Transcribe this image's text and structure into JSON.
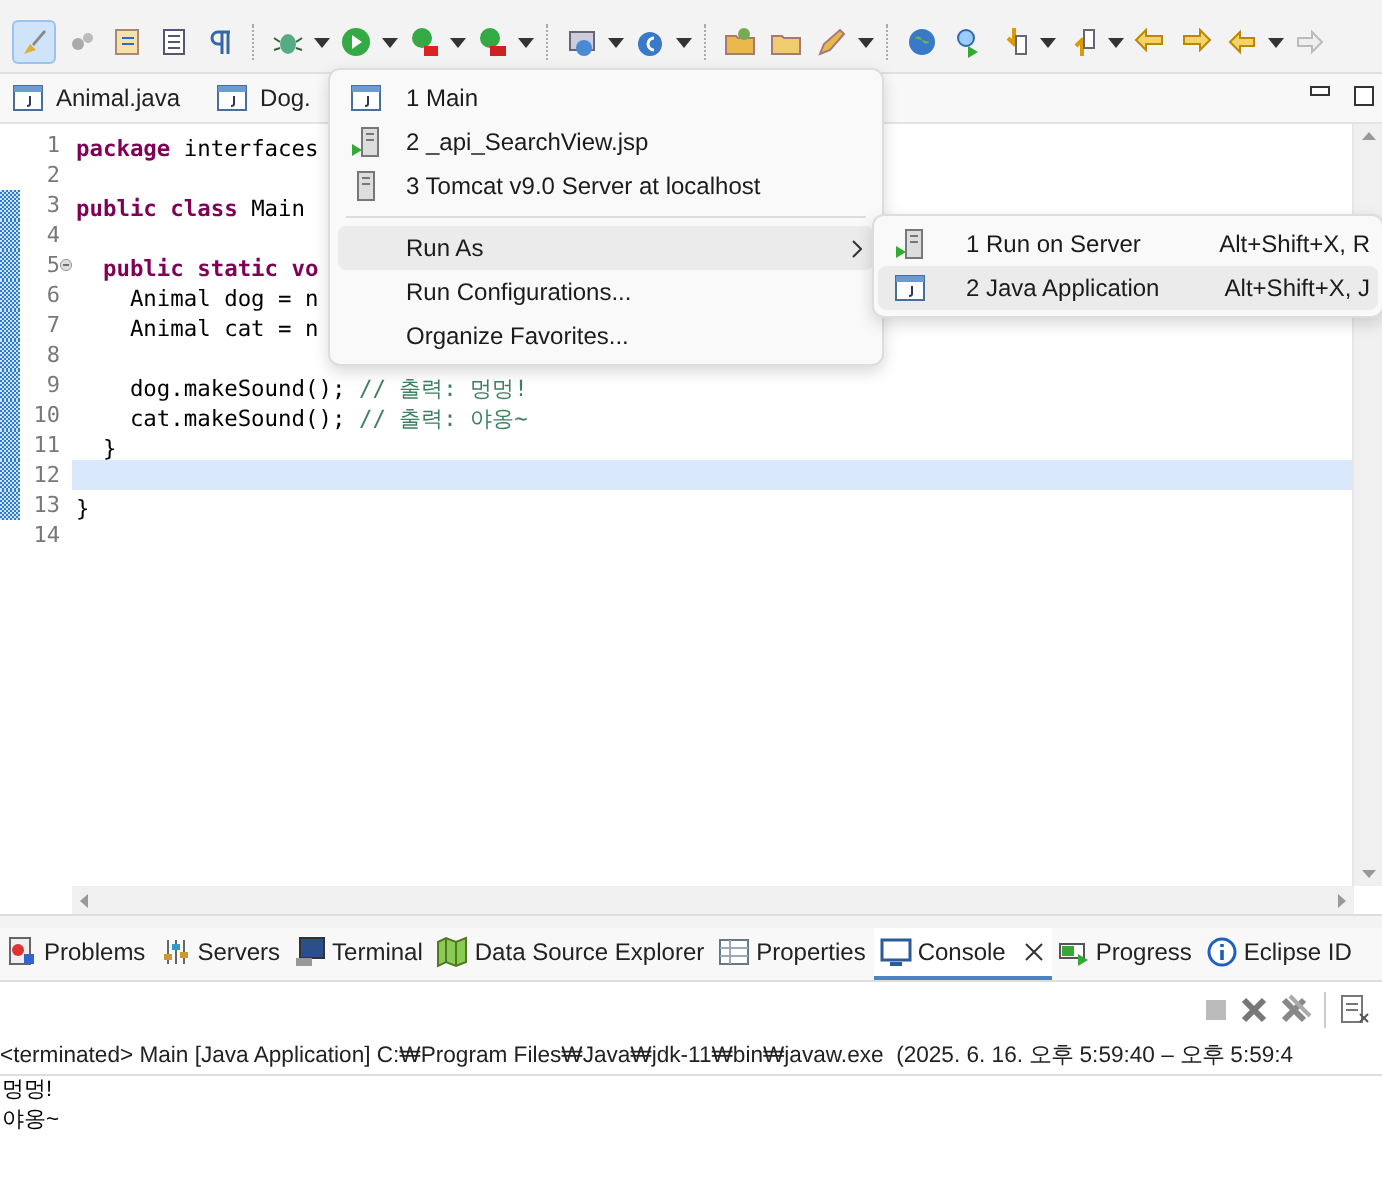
{
  "editor_tabs": [
    {
      "label": "Animal.java"
    },
    {
      "label": "Dog."
    }
  ],
  "editor": {
    "lines": [
      {
        "number": "1",
        "changed": false,
        "current": false,
        "fold": false,
        "tokens": [
          {
            "kind": "keyword",
            "text": "package"
          },
          {
            "kind": "plain",
            "text": " interfaces"
          }
        ]
      },
      {
        "number": "2",
        "changed": false,
        "current": false,
        "fold": false
      },
      {
        "number": "3",
        "changed": true,
        "current": false,
        "fold": false,
        "tokens": [
          {
            "kind": "keyword",
            "text": "public class"
          },
          {
            "kind": "plain",
            "text": " Main"
          }
        ]
      },
      {
        "number": "4",
        "changed": true,
        "current": false,
        "fold": false
      },
      {
        "number": "5",
        "changed": true,
        "current": false,
        "fold": true,
        "tokens": [
          {
            "kind": "keyword",
            "text": "  public static vo"
          }
        ]
      },
      {
        "number": "6",
        "changed": true,
        "current": false,
        "fold": false,
        "tokens": [
          {
            "kind": "plain",
            "text": "    Animal dog = n"
          }
        ]
      },
      {
        "number": "7",
        "changed": true,
        "current": false,
        "fold": false,
        "tokens": [
          {
            "kind": "plain",
            "text": "    Animal cat = n"
          }
        ]
      },
      {
        "number": "8",
        "changed": true,
        "current": false,
        "fold": false
      },
      {
        "number": "9",
        "changed": true,
        "current": false,
        "fold": false,
        "tokens": [
          {
            "kind": "plain",
            "text": "    dog.makeSound(); "
          },
          {
            "kind": "comment",
            "text": "// 출력: 멍멍!"
          }
        ]
      },
      {
        "number": "10",
        "changed": true,
        "current": false,
        "fold": false,
        "tokens": [
          {
            "kind": "plain",
            "text": "    cat.makeSound(); "
          },
          {
            "kind": "comment",
            "text": "// 출력: 야옹~"
          }
        ]
      },
      {
        "number": "11",
        "changed": true,
        "current": false,
        "fold": false,
        "tokens": [
          {
            "kind": "plain",
            "text": "  }"
          }
        ]
      },
      {
        "number": "12",
        "changed": true,
        "current": true,
        "fold": false
      },
      {
        "number": "13",
        "changed": true,
        "current": false,
        "fold": false,
        "tokens": [
          {
            "kind": "plain",
            "text": "}"
          }
        ]
      },
      {
        "number": "14",
        "changed": false,
        "current": false,
        "fold": false
      }
    ]
  },
  "run_menu": {
    "recent": [
      {
        "kind": "java",
        "label": "1 Main"
      },
      {
        "kind": "server-run",
        "label": "2 _api_SearchView.jsp"
      },
      {
        "kind": "server",
        "label": "3 Tomcat v9.0 Server at localhost"
      }
    ],
    "items": [
      {
        "label": "Run As",
        "submenu": true,
        "selected": true
      },
      {
        "label": "Run Configurations...",
        "submenu": false,
        "selected": false
      },
      {
        "label": "Organize Favorites...",
        "submenu": false,
        "selected": false
      }
    ]
  },
  "run_as_submenu": [
    {
      "kind": "server-run",
      "label": "1 Run on Server",
      "shortcut": "Alt+Shift+X, R",
      "selected": false
    },
    {
      "kind": "java",
      "label": "2 Java Application",
      "shortcut": "Alt+Shift+X, J",
      "selected": true
    }
  ],
  "view_tabs": [
    {
      "kind": "problems",
      "label": "Problems",
      "selected": false,
      "closable": false
    },
    {
      "kind": "servers",
      "label": "Servers",
      "selected": false,
      "closable": false
    },
    {
      "kind": "terminal",
      "label": "Terminal",
      "selected": false,
      "closable": false
    },
    {
      "kind": "datasource",
      "label": "Data Source Explorer",
      "selected": false,
      "closable": false
    },
    {
      "kind": "properties",
      "label": "Properties",
      "selected": false,
      "closable": false
    },
    {
      "kind": "console",
      "label": "Console",
      "selected": true,
      "closable": true
    },
    {
      "kind": "progress",
      "label": "Progress",
      "selected": false,
      "closable": false
    },
    {
      "kind": "info",
      "label": "Eclipse ID",
      "selected": false,
      "closable": false
    }
  ],
  "console": {
    "header": "<terminated> Main [Java Application] C:₩Program Files₩Java₩jdk-11₩bin₩javaw.exe  (2025. 6. 16. 오후 5:59:40 – 오후 5:59:4",
    "output": [
      "멍멍!",
      "야옹~"
    ]
  }
}
